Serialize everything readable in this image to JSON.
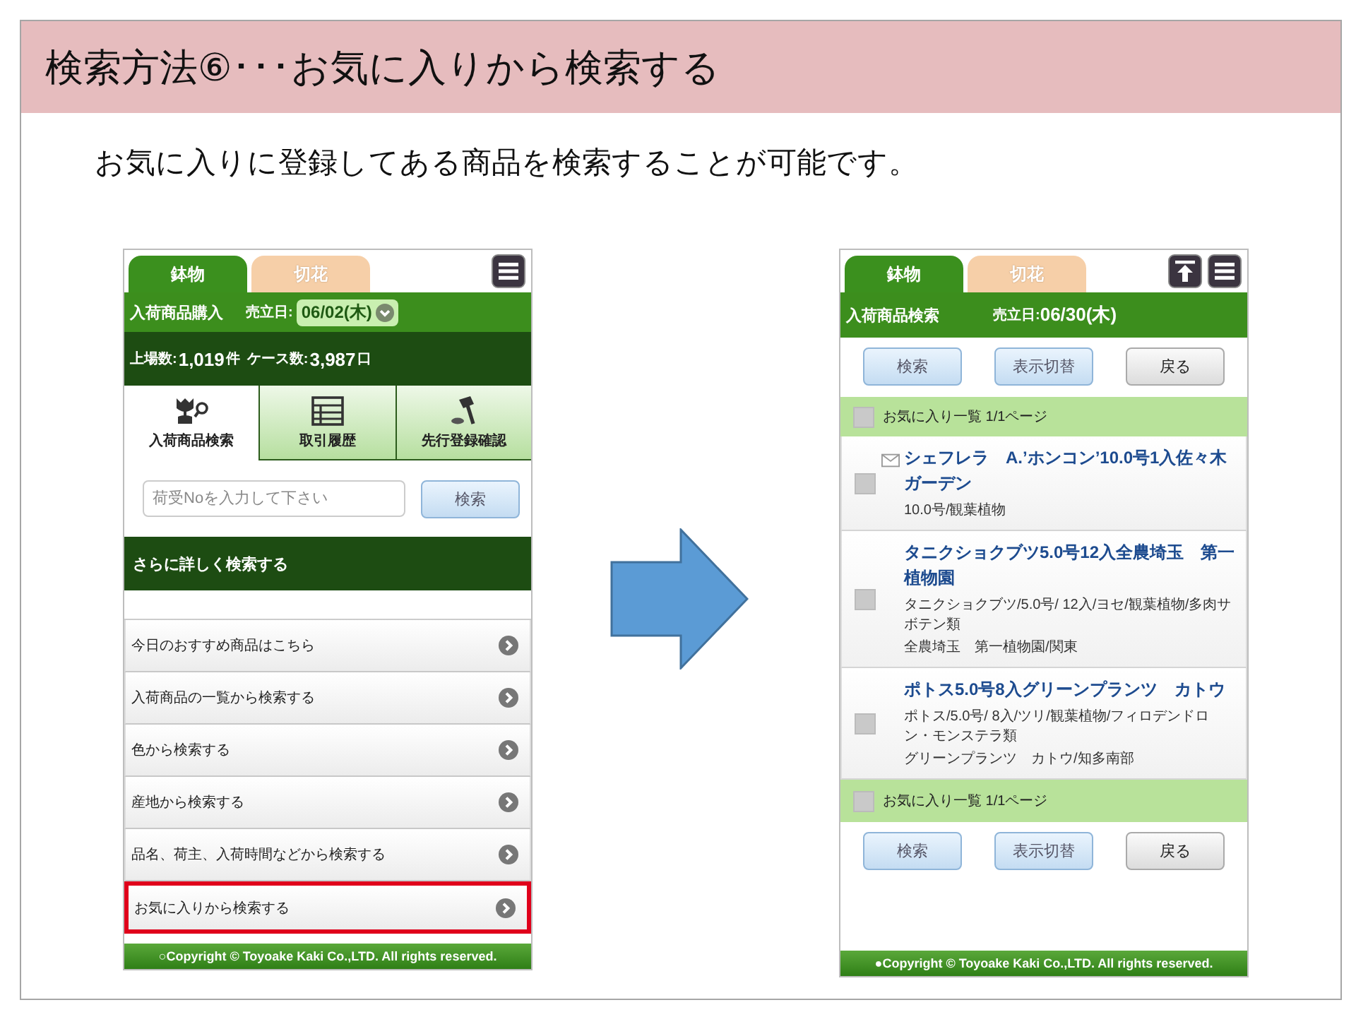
{
  "slide": {
    "title": "検索方法⑥･･･お気に入りから検索する",
    "subtitle": "お気に入りに登録してある商品を検索することが可能です。"
  },
  "left_screen": {
    "tabs": [
      {
        "label": "鉢物",
        "selected": true
      },
      {
        "label": "切花",
        "selected": false
      }
    ],
    "toolbar_icons": {
      "menu": true
    },
    "header": {
      "title": "入荷商品購入",
      "date_label": "売立日:",
      "date_value": "06/02(木)"
    },
    "stats": {
      "listed_label": "上場数:",
      "listed_value": "1,019",
      "listed_unit": "件",
      "cases_label": "ケース数:",
      "cases_value": "3,987",
      "cases_unit": "口"
    },
    "nav_tabs": [
      {
        "label": "入荷商品検索",
        "kind": "tulip-search",
        "selected": true
      },
      {
        "label": "取引履歴",
        "kind": "table",
        "selected": false
      },
      {
        "label": "先行登録確認",
        "kind": "gavel",
        "selected": false
      }
    ],
    "search": {
      "placeholder": "荷受Noを入力して下さい",
      "button": "検索"
    },
    "section_title": "さらに詳しく検索する",
    "menu_items": [
      {
        "label": "今日のおすすめ商品はこちら",
        "highlighted": false
      },
      {
        "label": "入荷商品の一覧から検索する",
        "highlighted": false
      },
      {
        "label": "色から検索する",
        "highlighted": false
      },
      {
        "label": "産地から検索する",
        "highlighted": false
      },
      {
        "label": "品名、荷主、入荷時間などから検索する",
        "highlighted": false
      },
      {
        "label": "お気に入りから検索する",
        "highlighted": true
      }
    ],
    "footer": "○Copyright © Toyoake Kaki Co.,LTD. All rights reserved."
  },
  "right_screen": {
    "tabs": [
      {
        "label": "鉢物",
        "selected": true
      },
      {
        "label": "切花",
        "selected": false
      }
    ],
    "toolbar_icons": {
      "scroll_top": true,
      "menu": true
    },
    "header": {
      "title": "入荷商品検索",
      "date_label": "売立日:",
      "date_value": "06/30(木)"
    },
    "toolbar_top": [
      {
        "label": "検索",
        "kind": "primary"
      },
      {
        "label": "表示切替",
        "kind": "primary"
      },
      {
        "label": "戻る",
        "kind": "secondary"
      }
    ],
    "list_header_top": {
      "label": "お気に入り一覧 1/1ページ",
      "checked": false
    },
    "items": [
      {
        "title": "シェフレラ　A.’ホンコン’10.0号1入佐々木ガーデン",
        "details": [
          "10.0号/観葉植物"
        ],
        "checked": false,
        "mail": true
      },
      {
        "title": "タニクショクブツ5.0号12入全農埼玉　第一植物園",
        "details": [
          "タニクショクブツ/5.0号/ 12入/ヨセ/観葉植物/多肉サボテン類",
          "全農埼玉　第一植物園/関東"
        ],
        "checked": false,
        "mail": false
      },
      {
        "title": "ポトス5.0号8入グリーンプランツ　カトウ",
        "details": [
          "ポトス/5.0号/ 8入/ツリ/観葉植物/フィロデンドロン・モンステラ類",
          "グリーンプランツ　カトウ/知多南部"
        ],
        "checked": false,
        "mail": false
      }
    ],
    "list_header_bottom": {
      "label": "お気に入り一覧 1/1ページ",
      "checked": false
    },
    "toolbar_bottom": [
      {
        "label": "検索",
        "kind": "primary"
      },
      {
        "label": "表示切替",
        "kind": "primary"
      },
      {
        "label": "戻る",
        "kind": "secondary"
      }
    ],
    "footer": "●Copyright © Toyoake Kaki Co.,LTD. All rights reserved."
  }
}
